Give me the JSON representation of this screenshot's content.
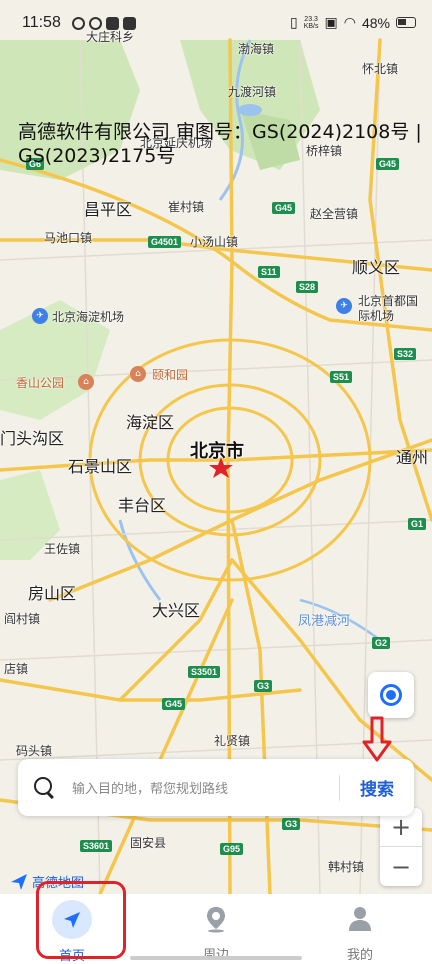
{
  "status": {
    "time": "11:58",
    "speed_top": "23.3",
    "speed_bottom": "KB/s",
    "battery": "48%"
  },
  "map": {
    "copyright": "高德软件有限公司 审图号：GS(2024)2108号 | GS(2023)2175号",
    "labels": {
      "top_partial": "大庄科乡",
      "bohai": "渤海镇",
      "huairou": "怀北镇",
      "jiuduhe": "九渡河镇",
      "airport_road": "北京延庆机场",
      "qiaozi": "桥梓镇",
      "changping": "昌平区",
      "cuicun": "崔村镇",
      "zhaoquanying": "赵全营镇",
      "machikou": "马池口镇",
      "xiaotangshan": "小汤山镇",
      "shunyi": "顺义区",
      "haidian_airport": "北京海淀机场",
      "capital_airport": "北京首都国际机场",
      "xiangshan": "香山公园",
      "yiheyuan": "颐和园",
      "haidian": "海淀区",
      "mentougou": "门头沟区",
      "beijing": "北京市",
      "tongzhou": "通州",
      "shijingshan": "石景山区",
      "fengtai": "丰台区",
      "wangzuo": "王佐镇",
      "fangshan": "房山区",
      "yanzhen": "阎村镇",
      "daxing": "大兴区",
      "fenggang": "凤港减河",
      "dianzhen": "店镇",
      "lixian": "礼贤镇",
      "matou": "码头镇",
      "gu_an": "固安县",
      "hancun": "韩村镇",
      "amap": "高德地图"
    },
    "shields": [
      "G6",
      "G45",
      "G45",
      "G4501",
      "S11",
      "S28",
      "S32",
      "S51",
      "G2",
      "S3501",
      "G45",
      "G3",
      "S3601",
      "G95",
      "G3",
      "G1"
    ]
  },
  "search": {
    "placeholder": "输入目的地，帮您规划路线",
    "button_label": "搜索"
  },
  "zoom": {
    "plus": "+",
    "minus": "−"
  },
  "nav": {
    "items": [
      {
        "label": "首页",
        "icon": "navigation-arrow-icon"
      },
      {
        "label": "周边",
        "icon": "location-pin-icon"
      },
      {
        "label": "我的",
        "icon": "person-icon"
      }
    ]
  },
  "colors": {
    "accent": "#1f5fd6",
    "highlight": "#e0222a",
    "road_major": "#f4c64c",
    "green_area": "#cfe6b8"
  }
}
